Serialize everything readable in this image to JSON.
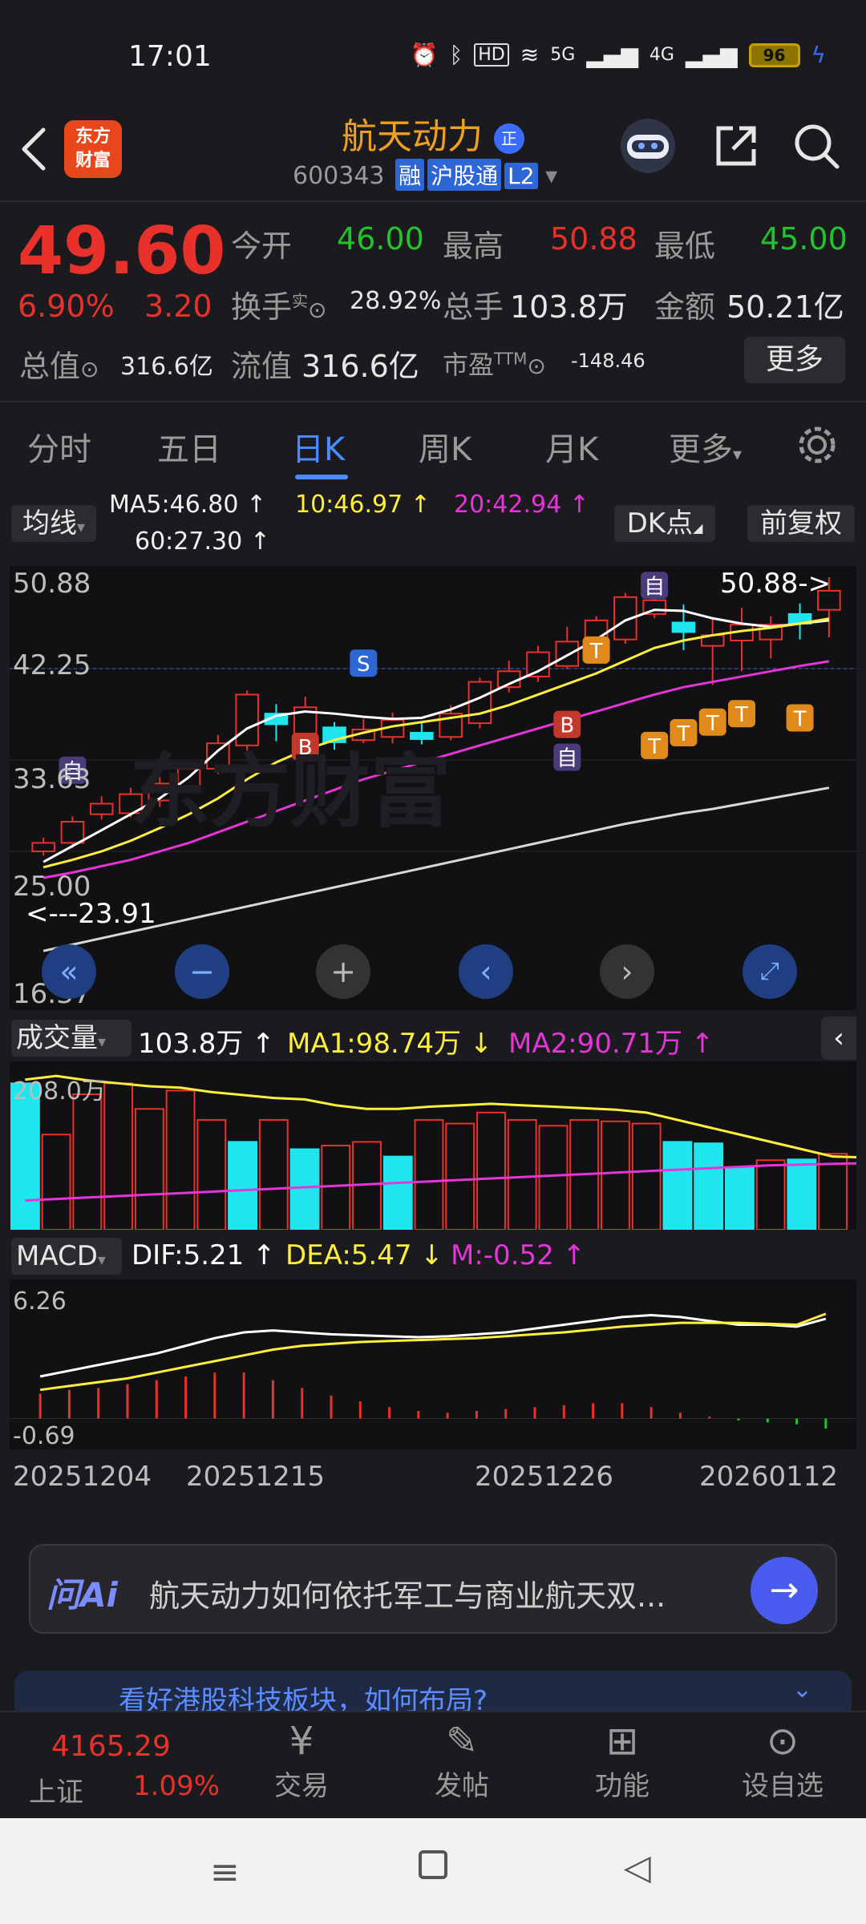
{
  "status": {
    "time": "17:01",
    "battery": "96",
    "signal1": "5G",
    "signal2": "4G",
    "hd": "HD"
  },
  "nav": {
    "logo_line1": "东方",
    "logo_line2": "财富",
    "name": "航天动力",
    "name_badge": "正",
    "code": "600343",
    "tags": [
      "融",
      "沪股通",
      "L2"
    ]
  },
  "quote": {
    "price": "49.60",
    "pct": "6.90%",
    "change": "3.20",
    "open_label": "今开",
    "open": "46.00",
    "high_label": "最高",
    "high": "50.88",
    "low_label": "最低",
    "low": "45.00",
    "turnover_label": "换手",
    "turnover_sup": "实",
    "turnover": "28.92%",
    "vol_label": "总手",
    "vol": "103.8万",
    "amount_label": "金额",
    "amount": "50.21亿",
    "mktcap_label": "总值",
    "mktcap": "316.6亿",
    "float_label": "流值",
    "float": "316.6亿",
    "pe_label": "市盈",
    "pe_sup": "TTM",
    "pe": "-148.46",
    "more": "更多"
  },
  "tabs": {
    "items": [
      "分时",
      "五日",
      "日K",
      "周K",
      "月K",
      "更多"
    ],
    "active": "日K"
  },
  "ma": {
    "toggle": "均线",
    "ma5": "MA5:46.80 ↑",
    "ma10": "10:46.97 ↑",
    "ma20": "20:42.94 ↑",
    "ma60": "60:27.30 ↑",
    "dk": "DK点",
    "adjust": "前复权"
  },
  "kchart": {
    "y_labels": [
      "50.88",
      "42.25",
      "33.63",
      "25.00",
      "16.37"
    ],
    "high_marker": "50.88->",
    "low_marker": "<---23.91",
    "watermark": "东方财富",
    "marker_self": "自",
    "marker_b": "B",
    "marker_s": "S",
    "marker_t": "T"
  },
  "volume": {
    "toggle": "成交量",
    "vol": "103.8万 ↑",
    "ma1": "MA1:98.74万 ↓",
    "ma2": "MA2:90.71万 ↑",
    "y_label": "208.0万"
  },
  "macd": {
    "toggle": "MACD",
    "dif": "DIF:5.21 ↑",
    "dea": "DEA:5.47 ↓",
    "m": "M:-0.52 ↑",
    "y_top": "6.26",
    "y_bottom": "-0.69"
  },
  "dates": [
    "20251204",
    "20251215",
    "20251226",
    "20260112"
  ],
  "ai": {
    "label": "问Ai",
    "text": "航天动力如何依托军工与商业航天双..."
  },
  "promo": {
    "text": "看好港股科技板块，如何布局?"
  },
  "bottom_nav": {
    "index_value": "4165.29",
    "index_name": "上证",
    "index_pct": "1.09%",
    "items": [
      "交易",
      "发帖",
      "功能",
      "设自选"
    ]
  },
  "chart_data": {
    "type": "candlestick",
    "y_range": [
      16.37,
      50.88
    ],
    "candles": [
      {
        "o": 25.0,
        "c": 25.8,
        "h": 26.3,
        "l": 24.6,
        "up": true
      },
      {
        "o": 25.8,
        "c": 27.8,
        "h": 28.3,
        "l": 25.3,
        "up": true
      },
      {
        "o": 28.5,
        "c": 29.5,
        "h": 30.2,
        "l": 28.0,
        "up": true
      },
      {
        "o": 28.6,
        "c": 30.4,
        "h": 31.0,
        "l": 28.2,
        "up": true
      },
      {
        "o": 29.8,
        "c": 31.4,
        "h": 32.0,
        "l": 29.2,
        "up": true
      },
      {
        "o": 31.1,
        "c": 32.8,
        "h": 33.4,
        "l": 30.6,
        "up": true
      },
      {
        "o": 32.8,
        "c": 35.2,
        "h": 36.0,
        "l": 32.3,
        "up": true
      },
      {
        "o": 35.0,
        "c": 39.8,
        "h": 40.2,
        "l": 34.5,
        "up": true
      },
      {
        "o": 38.0,
        "c": 37.0,
        "h": 38.9,
        "l": 35.4,
        "up": false
      },
      {
        "o": 35.8,
        "c": 38.6,
        "h": 39.6,
        "l": 35.3,
        "up": true
      },
      {
        "o": 36.7,
        "c": 35.3,
        "h": 37.2,
        "l": 34.6,
        "up": false
      },
      {
        "o": 35.5,
        "c": 36.5,
        "h": 37.5,
        "l": 35.2,
        "up": true
      },
      {
        "o": 35.8,
        "c": 37.4,
        "h": 38.1,
        "l": 35.2,
        "up": true
      },
      {
        "o": 36.2,
        "c": 35.6,
        "h": 37.1,
        "l": 35.1,
        "up": false
      },
      {
        "o": 35.8,
        "c": 38.0,
        "h": 38.8,
        "l": 35.5,
        "up": true
      },
      {
        "o": 37.1,
        "c": 41.0,
        "h": 41.4,
        "l": 36.6,
        "up": true
      },
      {
        "o": 40.5,
        "c": 42.0,
        "h": 43.0,
        "l": 40.0,
        "up": true
      },
      {
        "o": 41.5,
        "c": 43.8,
        "h": 44.4,
        "l": 41.0,
        "up": true
      },
      {
        "o": 42.5,
        "c": 44.8,
        "h": 46.2,
        "l": 42.2,
        "up": true
      },
      {
        "o": 44.0,
        "c": 46.8,
        "h": 47.2,
        "l": 43.6,
        "up": true
      },
      {
        "o": 45.0,
        "c": 49.0,
        "h": 49.4,
        "l": 44.6,
        "up": true
      },
      {
        "o": 47.4,
        "c": 48.7,
        "h": 50.1,
        "l": 47.0,
        "up": true
      },
      {
        "o": 46.6,
        "c": 45.7,
        "h": 48.3,
        "l": 44.0,
        "up": false
      },
      {
        "o": 44.4,
        "c": 45.4,
        "h": 47.0,
        "l": 40.7,
        "up": true
      },
      {
        "o": 44.9,
        "c": 46.4,
        "h": 48.0,
        "l": 42.0,
        "up": true
      },
      {
        "o": 45.0,
        "c": 46.4,
        "h": 47.2,
        "l": 43.2,
        "up": true
      },
      {
        "o": 46.5,
        "c": 47.4,
        "h": 48.4,
        "l": 45.0,
        "up": false
      },
      {
        "o": 47.8,
        "c": 49.6,
        "h": 50.88,
        "l": 45.2,
        "up": true
      }
    ],
    "volume": [
      {
        "v": 200,
        "up": false
      },
      {
        "v": 130,
        "up": true
      },
      {
        "v": 185,
        "up": true
      },
      {
        "v": 200,
        "up": true
      },
      {
        "v": 165,
        "up": true
      },
      {
        "v": 190,
        "up": true
      },
      {
        "v": 150,
        "up": true
      },
      {
        "v": 120,
        "up": false
      },
      {
        "v": 150,
        "up": true
      },
      {
        "v": 110,
        "up": false
      },
      {
        "v": 115,
        "up": true
      },
      {
        "v": 120,
        "up": true
      },
      {
        "v": 100,
        "up": false
      },
      {
        "v": 150,
        "up": true
      },
      {
        "v": 145,
        "up": true
      },
      {
        "v": 160,
        "up": true
      },
      {
        "v": 150,
        "up": true
      },
      {
        "v": 142,
        "up": true
      },
      {
        "v": 150,
        "up": true
      },
      {
        "v": 148,
        "up": true
      },
      {
        "v": 145,
        "up": true
      },
      {
        "v": 120,
        "up": false
      },
      {
        "v": 118,
        "up": false
      },
      {
        "v": 85,
        "up": false
      },
      {
        "v": 95,
        "up": true
      },
      {
        "v": 96,
        "up": false
      },
      {
        "v": 103.8,
        "up": true
      }
    ],
    "volume_range": [
      0,
      208.0
    ],
    "macd_range": [
      -0.69,
      6.26
    ],
    "series": [
      {
        "name": "MA5",
        "color": "#ffffff"
      },
      {
        "name": "MA10",
        "color": "#ffef3c"
      },
      {
        "name": "MA20",
        "color": "#e534d8"
      },
      {
        "name": "MA60",
        "color": "#d8d8d8"
      }
    ],
    "ma5": [
      24.0,
      25.5,
      27.0,
      28.5,
      30.0,
      32.0,
      34.5,
      36.6,
      37.8,
      38.2,
      38.0,
      37.7,
      37.5,
      37.6,
      38.4,
      39.5,
      40.8,
      42.0,
      43.5,
      45.0,
      46.8,
      47.8,
      47.7,
      47.0,
      46.5,
      46.2,
      46.5,
      46.8
    ],
    "ma10": [
      23.5,
      24.2,
      25.0,
      26.0,
      27.2,
      28.5,
      30.0,
      31.8,
      33.4,
      34.6,
      35.5,
      36.2,
      36.8,
      37.2,
      37.6,
      38.0,
      38.8,
      39.8,
      40.8,
      41.8,
      43.0,
      44.2,
      44.9,
      45.4,
      45.8,
      46.1,
      46.5,
      46.97
    ],
    "ma20": [
      22.5,
      23.0,
      23.6,
      24.2,
      25.0,
      25.8,
      26.8,
      27.8,
      28.8,
      29.8,
      30.8,
      31.8,
      32.6,
      33.4,
      34.2,
      35.0,
      35.8,
      36.6,
      37.4,
      38.2,
      39.0,
      39.8,
      40.5,
      41.0,
      41.5,
      42.0,
      42.5,
      42.94
    ],
    "ma60": [
      15.6,
      16.2,
      16.8,
      17.4,
      18.0,
      18.6,
      19.2,
      19.8,
      20.4,
      21.0,
      21.6,
      22.2,
      22.8,
      23.4,
      24.0,
      24.6,
      25.2,
      25.8,
      26.4,
      27.0,
      27.6,
      28.1,
      28.6,
      29.0,
      29.5,
      30.0,
      30.5,
      31.0
    ],
    "vol_ma1": [
      205,
      210,
      204,
      200,
      196,
      194,
      188,
      184,
      180,
      178,
      170,
      165,
      165,
      168,
      170,
      172,
      170,
      168,
      166,
      164,
      160,
      150,
      140,
      130,
      120,
      110,
      100,
      98.74
    ],
    "vol_ma2": [
      40,
      42,
      44,
      46,
      48,
      50,
      52,
      54,
      56,
      58,
      60,
      62,
      64,
      66,
      68,
      70,
      72,
      74,
      76,
      78,
      80,
      82,
      84,
      86,
      88,
      89,
      90,
      90.71
    ],
    "dif": [
      2.2,
      2.5,
      2.8,
      3.1,
      3.4,
      3.8,
      4.2,
      4.5,
      4.6,
      4.5,
      4.4,
      4.35,
      4.3,
      4.25,
      4.3,
      4.4,
      4.5,
      4.7,
      4.9,
      5.1,
      5.3,
      5.4,
      5.3,
      5.1,
      4.9,
      4.9,
      4.8,
      5.21
    ],
    "dea": [
      1.5,
      1.7,
      1.9,
      2.1,
      2.4,
      2.7,
      3.0,
      3.3,
      3.6,
      3.8,
      3.9,
      4.0,
      4.05,
      4.1,
      4.15,
      4.2,
      4.3,
      4.4,
      4.5,
      4.65,
      4.8,
      4.9,
      5.0,
      5.0,
      5.0,
      4.95,
      4.9,
      5.47
    ],
    "macd_hist": [
      1.3,
      1.5,
      1.6,
      1.8,
      2.0,
      2.2,
      2.4,
      2.4,
      2.0,
      1.6,
      1.2,
      0.9,
      0.6,
      0.4,
      0.3,
      0.4,
      0.5,
      0.6,
      0.7,
      0.8,
      0.8,
      0.6,
      0.3,
      0.1,
      -0.1,
      -0.2,
      -0.3,
      -0.52
    ]
  }
}
